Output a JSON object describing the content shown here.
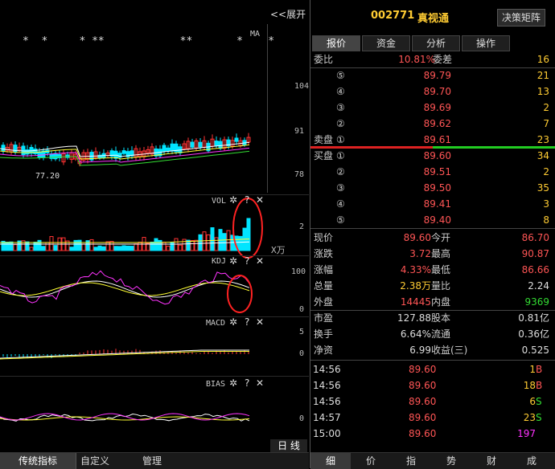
{
  "left": {
    "expand_label": "<<展开",
    "ma_label": "MA",
    "stars": "*  *     * **            **       *    *",
    "main_axis": [
      "104",
      "91",
      "78"
    ],
    "low_label": "77.20",
    "panels": [
      {
        "title": "VOL",
        "axis": [
          "2"
        ],
        "unit": "X万"
      },
      {
        "title": "KDJ",
        "axis": [
          "100",
          "0"
        ]
      },
      {
        "title": "MACD",
        "axis": [
          "5",
          "0"
        ]
      },
      {
        "title": "BIAS",
        "axis": [
          "0"
        ]
      }
    ],
    "panel_icons": {
      "gear": "✲",
      "help": "?",
      "close": "✕"
    },
    "day_label": "日 线",
    "bottom_tabs": [
      "传统指标",
      "自定义",
      "管理"
    ]
  },
  "header": {
    "code": "002771",
    "name": "真视通",
    "decision_button": "决策矩阵",
    "tabs": [
      "报价",
      "资金",
      "分析",
      "操作"
    ]
  },
  "order_book": {
    "weibi_label": "委比",
    "weibi_value": "10.81%",
    "weicha_label": "委差",
    "weicha_value": "16",
    "sell_label": "卖盘",
    "buy_label": "买盘",
    "sell": [
      {
        "n": "⑤",
        "price": "89.79",
        "vol": "21"
      },
      {
        "n": "④",
        "price": "89.70",
        "vol": "13"
      },
      {
        "n": "③",
        "price": "89.69",
        "vol": "2"
      },
      {
        "n": "②",
        "price": "89.62",
        "vol": "7"
      },
      {
        "n": "①",
        "price": "89.61",
        "vol": "23"
      }
    ],
    "buy": [
      {
        "n": "①",
        "price": "89.60",
        "vol": "34"
      },
      {
        "n": "②",
        "price": "89.51",
        "vol": "2"
      },
      {
        "n": "③",
        "price": "89.50",
        "vol": "35"
      },
      {
        "n": "④",
        "price": "89.41",
        "vol": "3"
      },
      {
        "n": "⑤",
        "price": "89.40",
        "vol": "8"
      }
    ]
  },
  "quote": [
    {
      "l1": "现价",
      "v1": "89.60",
      "c1": "red",
      "l2": "今开",
      "v2": "86.70",
      "c2": "red"
    },
    {
      "l1": "涨跌",
      "v1": "3.72",
      "c1": "red",
      "l2": "最高",
      "v2": "90.87",
      "c2": "red"
    },
    {
      "l1": "涨幅",
      "v1": "4.33%",
      "c1": "red",
      "l2": "最低",
      "v2": "86.66",
      "c2": "red"
    },
    {
      "l1": "总量",
      "v1": "2.38万",
      "c1": "yellow",
      "l2": "量比",
      "v2": "2.24",
      "c2": "white"
    },
    {
      "l1": "外盘",
      "v1": "14445",
      "c1": "red",
      "l2": "内盘",
      "v2": "9369",
      "c2": "green"
    }
  ],
  "stats": [
    {
      "l1": "市盈",
      "v1": "127.88",
      "l2": "股本",
      "v2": "0.81亿"
    },
    {
      "l1": "换手",
      "v1": "6.64%",
      "l2": "流通",
      "v2": "0.36亿"
    },
    {
      "l1": "净资",
      "v1": "6.99",
      "l2": "收益(三)",
      "v2": "0.525"
    }
  ],
  "ticks": [
    {
      "time": "14:56",
      "price": "89.60",
      "vol": "1",
      "vc": "yellow",
      "dir": "B",
      "dc": "red"
    },
    {
      "time": "14:56",
      "price": "89.60",
      "vol": "18",
      "vc": "yellow",
      "dir": "B",
      "dc": "red"
    },
    {
      "time": "14:56",
      "price": "89.60",
      "vol": "6",
      "vc": "yellow",
      "dir": "S",
      "dc": "green"
    },
    {
      "time": "14:57",
      "price": "89.60",
      "vol": "23",
      "vc": "yellow",
      "dir": "S",
      "dc": "green"
    },
    {
      "time": "15:00",
      "price": "89.60",
      "vol": "197",
      "vc": "magenta",
      "dir": "",
      "dc": "white"
    }
  ],
  "right_bottom_tabs": [
    "细",
    "价",
    "指",
    "势",
    "财",
    "成"
  ],
  "colors": {
    "up": "#ff3333",
    "down": "#00e5ff",
    "accent": "#ffcc33",
    "ma_white": "#ffffff",
    "ma_yellow": "#ffff33",
    "ma_magenta": "#ff33ff",
    "ma_green": "#33dd33"
  }
}
